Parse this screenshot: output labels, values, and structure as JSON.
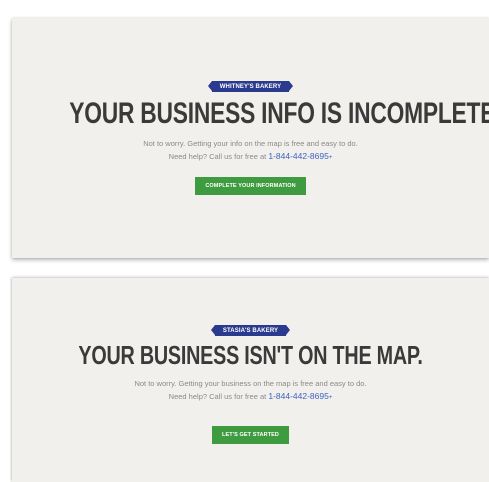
{
  "card1": {
    "ribbon": "WHITNEY'S BAKERY",
    "headline": "YOUR BUSINESS INFO IS INCOMPLETE.",
    "line1": "Not to worry. Getting your info on the map is free and easy to do.",
    "line2_prefix": "Need help? Call us for free at ",
    "phone": "1-844-442-8695",
    "phone_suffix": "+",
    "cta": "COMPLETE YOUR INFORMATION"
  },
  "card2": {
    "ribbon": "STASIA'S BAKERY",
    "headline": "YOUR BUSINESS ISN'T ON THE MAP.",
    "line1": "Not to worry. Getting your business on the map is free and easy to do.",
    "line2_prefix": "Need help? Call us for free at ",
    "phone": "1-844-442-8695",
    "phone_suffix": "+",
    "cta": "LET'S GET STARTED"
  },
  "colors": {
    "ribbon": "#2a3a8f",
    "cta": "#3f9b3f",
    "phone": "#3d62c4",
    "card_bg": "#f2f0ec",
    "headline": "#3a3a3a"
  }
}
